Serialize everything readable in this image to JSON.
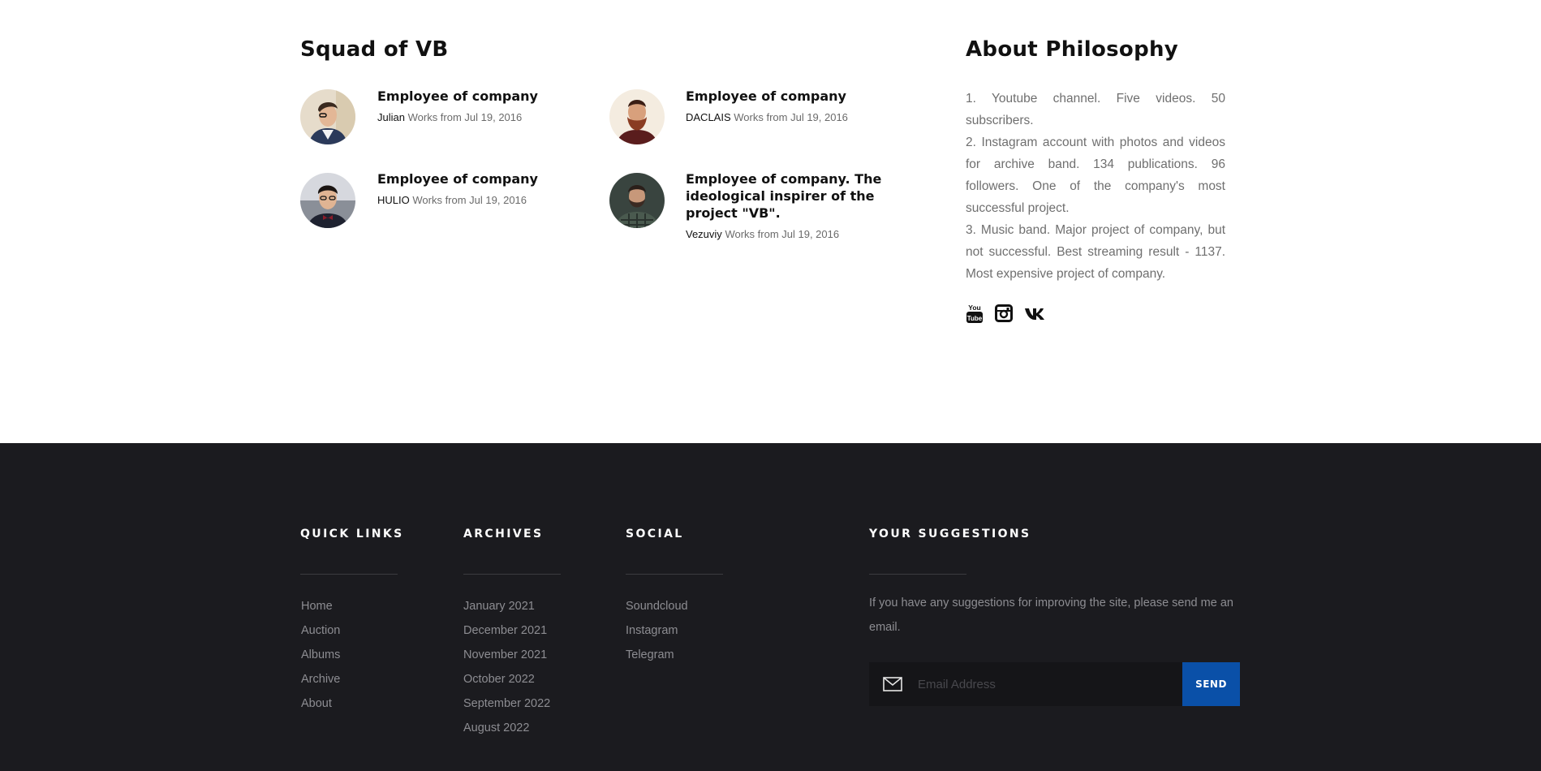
{
  "squad": {
    "heading": "Squad of VB",
    "employees": [
      {
        "title": "Employee of company",
        "name": "Julian",
        "since": "Works from Jul 19, 2016"
      },
      {
        "title": "Employee of company",
        "name": "DACLAIS",
        "since": "Works from Jul 19, 2016"
      },
      {
        "title": "Employee of company",
        "name": "HULIO",
        "since": "Works from Jul 19, 2016"
      },
      {
        "title": "Employee of company. The ideological inspirer of the project \"VB\".",
        "name": "Vezuviy",
        "since": "Works from Jul 19, 2016"
      }
    ]
  },
  "philosophy": {
    "heading": "About Philosophy",
    "paragraphs": [
      "1. Youtube channel. Five videos. 50 subscribers.",
      "2. Instagram account with photos and videos for archive band. 134 publications. 96 followers. One of the company's most successful project.",
      "3. Music band. Major project of company, but not successful. Best streaming result - 1137. Most expensive project of company."
    ],
    "social_icons": [
      "youtube-icon",
      "instagram-icon",
      "vk-icon"
    ]
  },
  "footer": {
    "quick_links": {
      "title": "QUICK LINKS",
      "items": [
        "Home",
        "Auction",
        "Albums",
        "Archive",
        "About"
      ]
    },
    "archives": {
      "title": "ARCHIVES",
      "items": [
        "January 2021",
        "December 2021",
        "November 2021",
        "October 2022",
        "September 2022",
        "August 2022"
      ]
    },
    "social": {
      "title": "SOCIAL",
      "items": [
        "Soundcloud",
        "Instagram",
        "Telegram"
      ]
    },
    "suggestions": {
      "title": "YOUR SUGGESTIONS",
      "text": "If you have any suggestions for improving the site, please send me an email.",
      "placeholder": "Email Address",
      "button": "SEND"
    }
  },
  "colors": {
    "footer_bg": "#1b1b1f",
    "accent": "#0a50a8"
  }
}
